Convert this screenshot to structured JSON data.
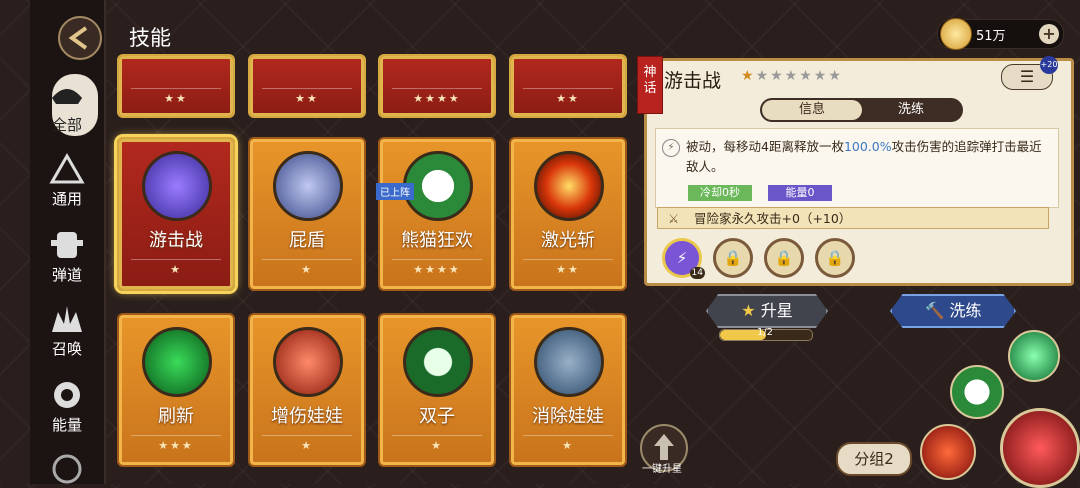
{
  "header": {
    "title": "技能",
    "coin_value": "51万"
  },
  "sidebar": {
    "items": [
      {
        "label": "全部",
        "icon": "hat-icon",
        "active": true
      },
      {
        "label": "通用",
        "icon": "triangle-icon"
      },
      {
        "label": "弹道",
        "icon": "armor-icon"
      },
      {
        "label": "召唤",
        "icon": "summon-icon"
      },
      {
        "label": "能量",
        "icon": "energy-icon"
      }
    ]
  },
  "cards_row1": [
    {
      "name": "游击战",
      "stars": "★",
      "red": true,
      "selected": true
    },
    {
      "name": "屁盾",
      "stars": "★"
    },
    {
      "name": "熊猫狂欢",
      "stars": "★★★★",
      "deployed": "已上阵"
    },
    {
      "name": "激光斩",
      "stars": "★★"
    }
  ],
  "cards_row2": [
    {
      "name": "刷新",
      "stars": "★★★"
    },
    {
      "name": "增伤娃娃",
      "stars": "★"
    },
    {
      "name": "双子",
      "stars": "★"
    },
    {
      "name": "消除娃娃",
      "stars": "★"
    }
  ],
  "cards_row0": [
    {
      "stars": "★★"
    },
    {
      "stars": "★★"
    },
    {
      "stars": "★★★★"
    },
    {
      "stars": "★★"
    }
  ],
  "panel": {
    "tag": "神话",
    "title": "游击战",
    "tabs": [
      "信息",
      "洗练"
    ],
    "desc_pre": "被动，每移动4距离释放一枚",
    "desc_hl": "100.0%",
    "desc_post": "攻击伤害的追踪弹打击最近敌人。",
    "badge_cd": "冷却0秒",
    "badge_energy": "能量0",
    "bonus": "冒险家永久攻击+0（+10）",
    "slot_level": "14",
    "notify": "+20"
  },
  "buttons": {
    "upgrade": "升星",
    "reforge": "洗练",
    "progress": "1/2",
    "onekey": "一键升星",
    "group": "分组2"
  },
  "colors": {
    "card_orange": "#e8962a",
    "card_red": "#b3291e",
    "panel_bg": "#f4ecdb",
    "highlight": "#3b78c8"
  }
}
